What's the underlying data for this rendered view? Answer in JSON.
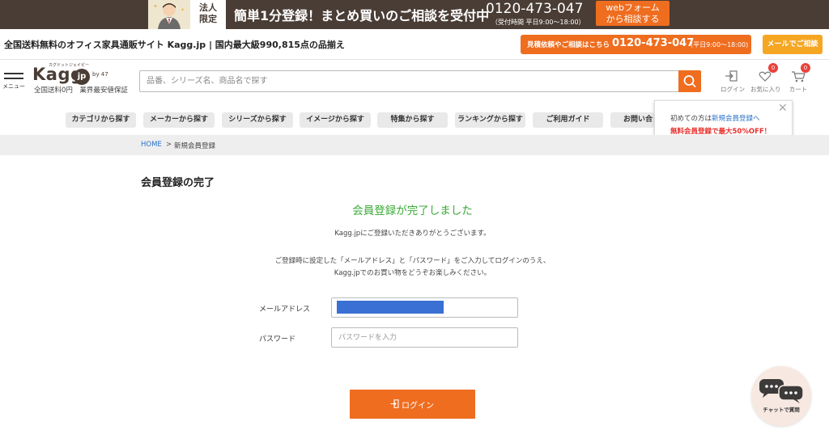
{
  "banner": {
    "hojin_line1": "法人",
    "hojin_line2": "限定",
    "promo": "簡単1分登録！まとめ買いのご相談を受付中",
    "tel": "0120-473-047",
    "hours": "（受付時間 平日9:00～18:00）",
    "web_line1": "webフォーム",
    "web_line2": "から相談する"
  },
  "infobar": {
    "site_desc": "全国送料無料のオフィス家具通販サイト Kagg.jp | 国内最大級990,815点の品揃え",
    "contact_label": "見積依頼やご相談はこちら",
    "contact_tel": "0120-473-047",
    "contact_hours": "(平日9:00～18:00)",
    "mail_button": "メールでご相談"
  },
  "header": {
    "menu_label": "メニュー",
    "logo_word": "Kagg",
    "logo_jp": "jp",
    "logo_by": "by 47",
    "logo_ruby": "カグドットジェイピー",
    "logo_sub": "全国送料0円　業界最安値保証",
    "search_placeholder": "品番、シリーズ名、商品名で探す",
    "login_label": "ログイン",
    "favorites_label": "お気に入り",
    "favorites_count": "0",
    "cart_label": "カート",
    "cart_count": "0"
  },
  "nav": {
    "items": [
      "カテゴリから探す",
      "メーカーから探す",
      "シリーズから探す",
      "イメージから探す",
      "特集から探す",
      "ランキングから探す",
      "ご利用ガイド",
      "お問い合"
    ]
  },
  "popup": {
    "prefix": "初めての方は",
    "link": "新規会員登録へ",
    "offer": "無料会員登録で最大50%OFF！",
    "close": "✕"
  },
  "breadcrumb": {
    "home": "HOME",
    "sep": ">",
    "current": "新規会員登録"
  },
  "main": {
    "title": "会員登録の完了",
    "done_message": "会員登録が完了しました",
    "thanks": "Kagg.jpにご登録いただきありがとうございます。",
    "instruction_line1": "ご登録時に設定した「メールアドレス」と「パスワード」をご入力してログインのうえ、",
    "instruction_line2": "Kagg.jpでのお買い物をどうぞお楽しみください。",
    "email_label": "メールアドレス",
    "email_value": "",
    "password_label": "パスワード",
    "password_placeholder": "パスワードを入力",
    "login_button": "ログイン"
  },
  "chat": {
    "label": "チャットで質問"
  },
  "colors": {
    "brand_dark": "#4a3d35",
    "accent_orange": "#ef6d1f",
    "success_green": "#3aaa35",
    "link_blue": "#2a73c9",
    "offer_red": "#e8302c",
    "email_redaction": "#3a70d3"
  }
}
